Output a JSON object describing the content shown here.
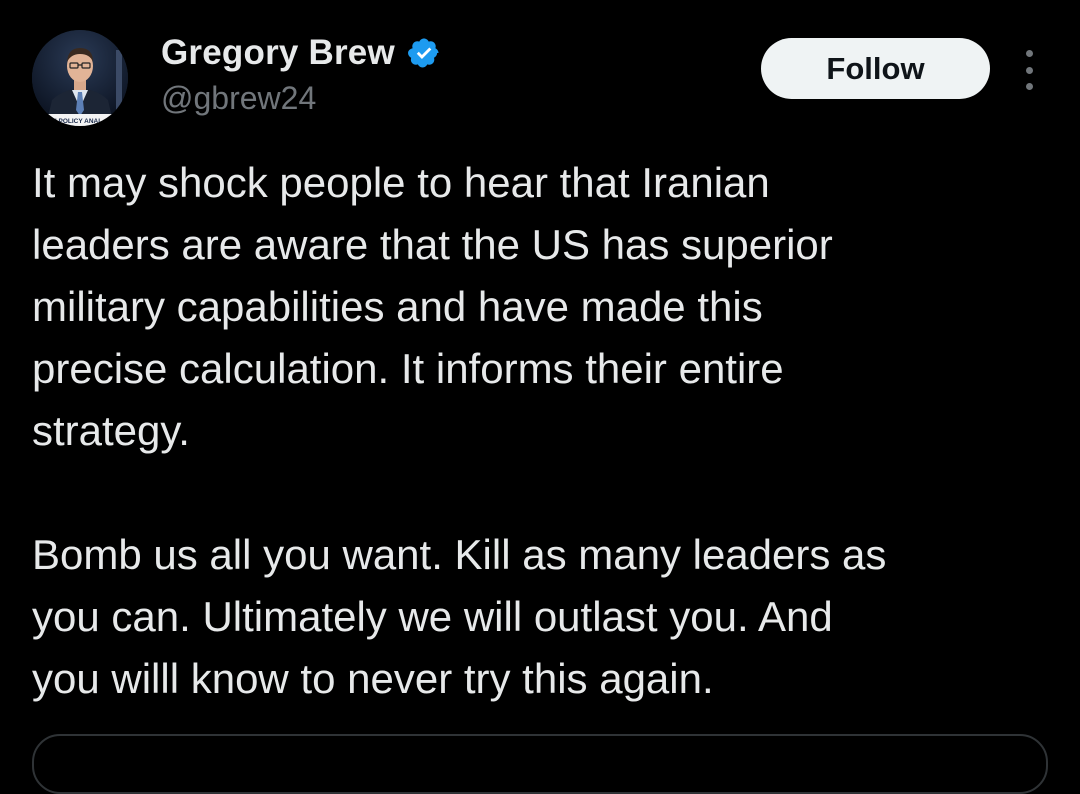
{
  "author": {
    "display_name": "Gregory Brew",
    "handle": "@gbrew24",
    "verified": true,
    "avatar_icon": "profile-photo",
    "avatar_caption_text": "N POLICY ANAL"
  },
  "actions": {
    "follow_label": "Follow",
    "more_icon": "more-vertical-icon"
  },
  "tweet": {
    "paragraphs": [
      "It may shock people to hear that Iranian\nleaders are aware that the US has superior\nmilitary capabilities and have made this\nprecise calculation. It informs their entire\nstrategy.",
      "Bomb us all you want. Kill as many leaders as\nyou can. Ultimately we will outlast you. And\nyou willl know to never try this again."
    ]
  },
  "colors": {
    "background": "#000000",
    "text_primary": "#e7e9ea",
    "text_secondary": "#71767b",
    "verified_blue": "#1d9bf0",
    "follow_bg": "#eff3f4",
    "follow_text": "#0f1419"
  }
}
